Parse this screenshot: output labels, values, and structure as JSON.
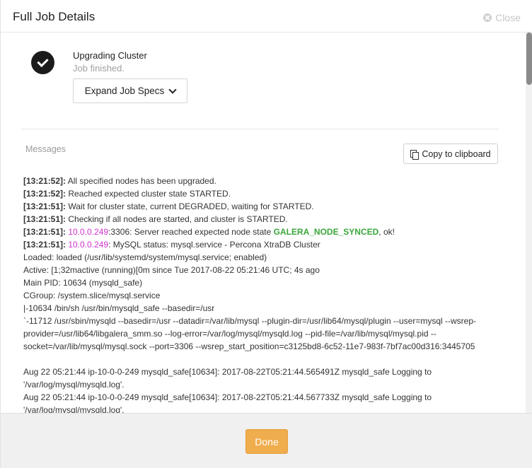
{
  "header": {
    "title": "Full Job Details",
    "close_label": "Close"
  },
  "job": {
    "title": "Upgrading Cluster",
    "status": "Job finished.",
    "expand_label": "Expand Job Specs"
  },
  "messages": {
    "label": "Messages",
    "copy_label": "Copy to clipboard",
    "log": [
      {
        "ts": "[13:21:52]:",
        "text": " All specified nodes has been upgraded."
      },
      {
        "ts": "[13:21:52]:",
        "text": " Reached expected cluster state STARTED."
      },
      {
        "ts": "[13:21:51]:",
        "text": " Wait for cluster state, current DEGRADED, waiting for STARTED."
      },
      {
        "ts": "[13:21:51]:",
        "text": " Checking if all nodes are started, and cluster is STARTED."
      },
      {
        "ts": "[13:21:51]:",
        "ip": " 10.0.0.249",
        "text": ":3306: Server reached expected node state ",
        "green": "GALERA_NODE_SYNCED",
        "tail": ", ok!"
      },
      {
        "ts": "[13:21:51]:",
        "ip": " 10.0.0.249",
        "text": ": MySQL status: mysql.service - Percona XtraDB Cluster"
      }
    ],
    "raw": [
      "Loaded: loaded (/usr/lib/systemd/system/mysql.service; enabled)",
      "Active: [1;32mactive (running)[0m since Tue 2017-08-22 05:21:46 UTC; 4s ago",
      "Main PID: 10634 (mysqld_safe)",
      "CGroup: /system.slice/mysql.service",
      "|-10634 /bin/sh /usr/bin/mysqld_safe --basedir=/usr",
      "`-11712 /usr/sbin/mysqld --basedir=/usr --datadir=/var/lib/mysql --plugin-dir=/usr/lib64/mysql/plugin --user=mysql --wsrep-provider=/usr/lib64/libgalera_smm.so --log-error=/var/log/mysql/mysqld.log --pid-file=/var/lib/mysql/mysql.pid --socket=/var/lib/mysql/mysql.sock --port=3306 --wsrep_start_position=c3125bd8-6c52-11e7-983f-7bf7ac00d316:3445705",
      "",
      "Aug 22 05:21:44 ip-10-0-0-249 mysqld_safe[10634]: 2017-08-22T05:21:44.565491Z mysqld_safe Logging to '/var/log/mysql/mysqld.log'.",
      "Aug 22 05:21:44 ip-10-0-0-249 mysqld_safe[10634]: 2017-08-22T05:21:44.567733Z mysqld_safe Logging to '/var/log/mysql/mysqld.log'."
    ]
  },
  "footer": {
    "done_label": "Done"
  },
  "colors": {
    "accent": "#f0ad4e",
    "ip": "#cc33cc",
    "synced": "#3aa63a"
  }
}
